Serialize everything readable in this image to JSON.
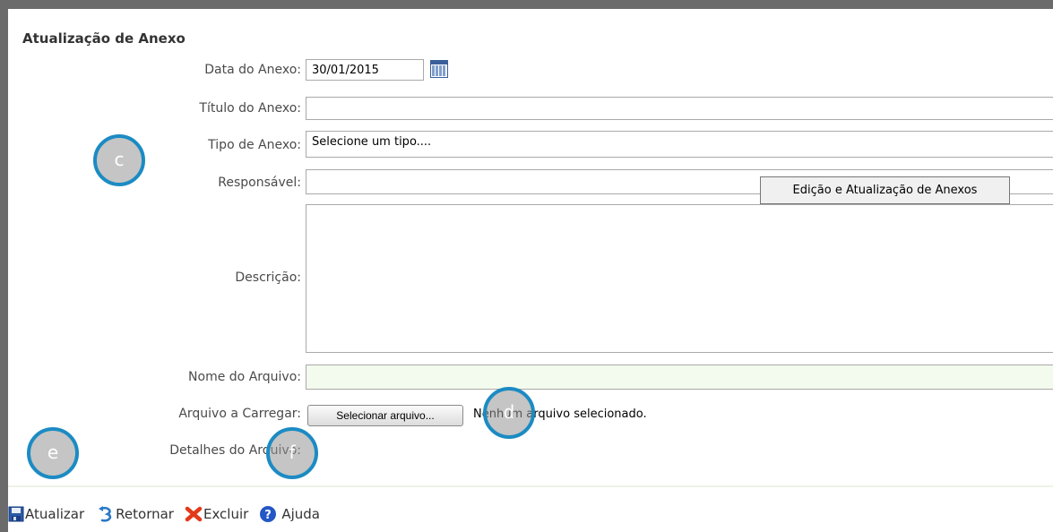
{
  "form": {
    "title": "Atualização de Anexo",
    "date_label": "Data do Anexo:",
    "date_value": "30/01/2015",
    "title_label": "Título do Anexo:",
    "title_value": "",
    "type_label": "Tipo de Anexo:",
    "type_selected": "Selecione um tipo....",
    "responsible_label": "Responsável:",
    "responsible_value": "",
    "description_label": "Descrição:",
    "description_value": "",
    "filename_label": "Nome do Arquivo:",
    "filename_value": "",
    "upload_label": "Arquivo a Carregar:",
    "upload_button": "Selecionar arquivo...",
    "upload_status": "Nenhum arquivo selecionado.",
    "details_label": "Detalhes do Arquivo:"
  },
  "tooltip": {
    "text": "Edição e Atualização de Anexos"
  },
  "toolbar": {
    "update": "Atualizar",
    "back": "Retornar",
    "delete": "Excluir",
    "help": "Ajuda"
  },
  "markers": {
    "c": "c",
    "d": "d",
    "e": "e",
    "f": "f"
  },
  "icons": {
    "calendar": "calendar-icon",
    "save": "save-icon",
    "back": "back-arrow-icon",
    "delete": "delete-x-icon",
    "help": "help-icon"
  },
  "colors": {
    "filename_field_bg": "#f3fbee",
    "marker_border": "#1c8bc3",
    "frame": "#6b6b6b"
  }
}
